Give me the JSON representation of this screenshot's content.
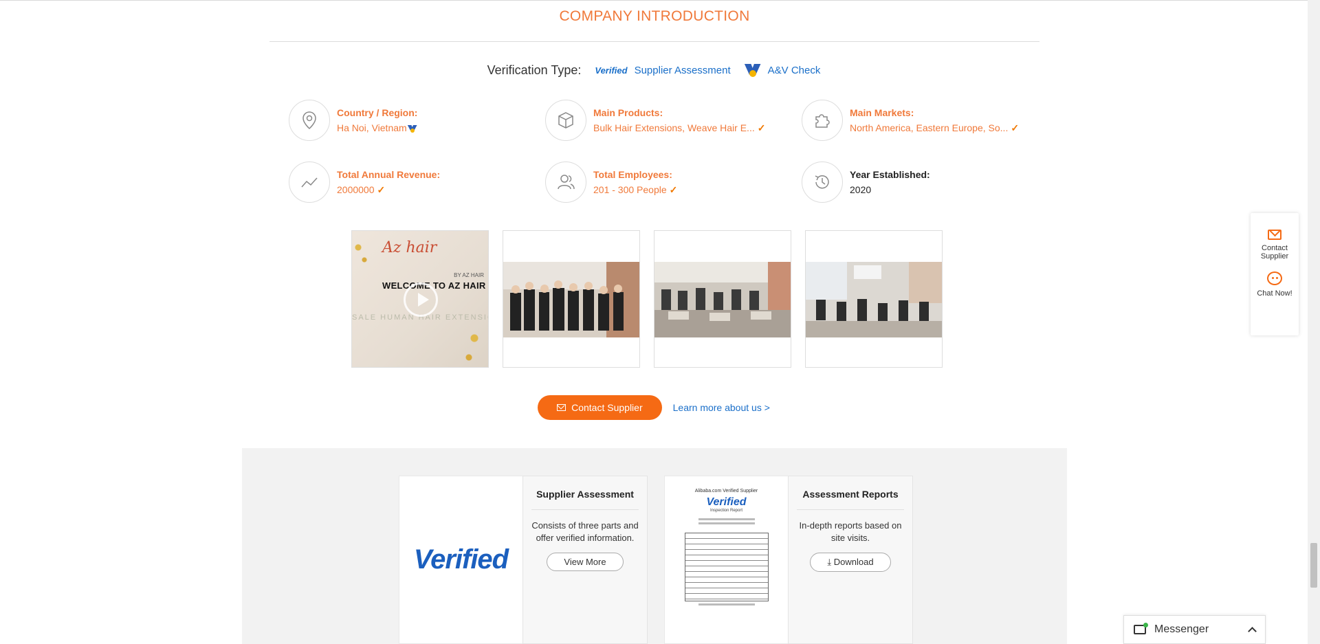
{
  "section": {
    "title": "COMPANY INTRODUCTION"
  },
  "verification": {
    "label": "Verification Type:",
    "verified_mark": "Verified",
    "supplier_assessment": "Supplier Assessment",
    "av_check": "A&V Check"
  },
  "facts": [
    {
      "key": "Country / Region:",
      "value": "Ha Noi, Vietnam",
      "icon": "location-pin-icon",
      "checked": false,
      "flag": true
    },
    {
      "key": "Main Products:",
      "value": "Bulk Hair Extensions, Weave Hair E...",
      "icon": "box-icon",
      "checked": true
    },
    {
      "key": "Main Markets:",
      "value": "North America, Eastern Europe, So...",
      "icon": "puzzle-icon",
      "checked": true
    },
    {
      "key": "Total Annual Revenue:",
      "value": "2000000",
      "icon": "trend-line-icon",
      "checked": true
    },
    {
      "key": "Total Employees:",
      "value": "201 - 300 People",
      "icon": "people-icon",
      "checked": true
    },
    {
      "key": "Year Established:",
      "value": "2020",
      "icon": "history-clock-icon",
      "checked": false
    }
  ],
  "gallery": {
    "video": {
      "logo_text": "Az hair",
      "by_text": "BY AZ HAIR",
      "welcome_text": "WELCOME TO AZ HAIR COMP",
      "bale_text": "SALE HUMAN HAIR EXTENSION"
    }
  },
  "cta": {
    "contact_label": "Contact Supplier",
    "learn_more": "Learn more about us >"
  },
  "assessment_cards": [
    {
      "image_text": "Verified",
      "title": "Supplier Assessment",
      "desc": "Consists of three parts and offer verified information.",
      "button": "View More"
    },
    {
      "report_header": "Alibaba.com Verified Supplier",
      "report_mark": "Verified",
      "report_sub": "Inspection Report",
      "title": "Assessment Reports",
      "desc": "In-depth reports based on site visits.",
      "button": "Download"
    }
  ],
  "side_panel": {
    "contact": "Contact Supplier",
    "chat": "Chat Now!"
  },
  "messenger": {
    "label": "Messenger"
  },
  "colors": {
    "accent": "#f56a14",
    "link": "#1a6fc9",
    "orange_text": "#f0793a"
  }
}
